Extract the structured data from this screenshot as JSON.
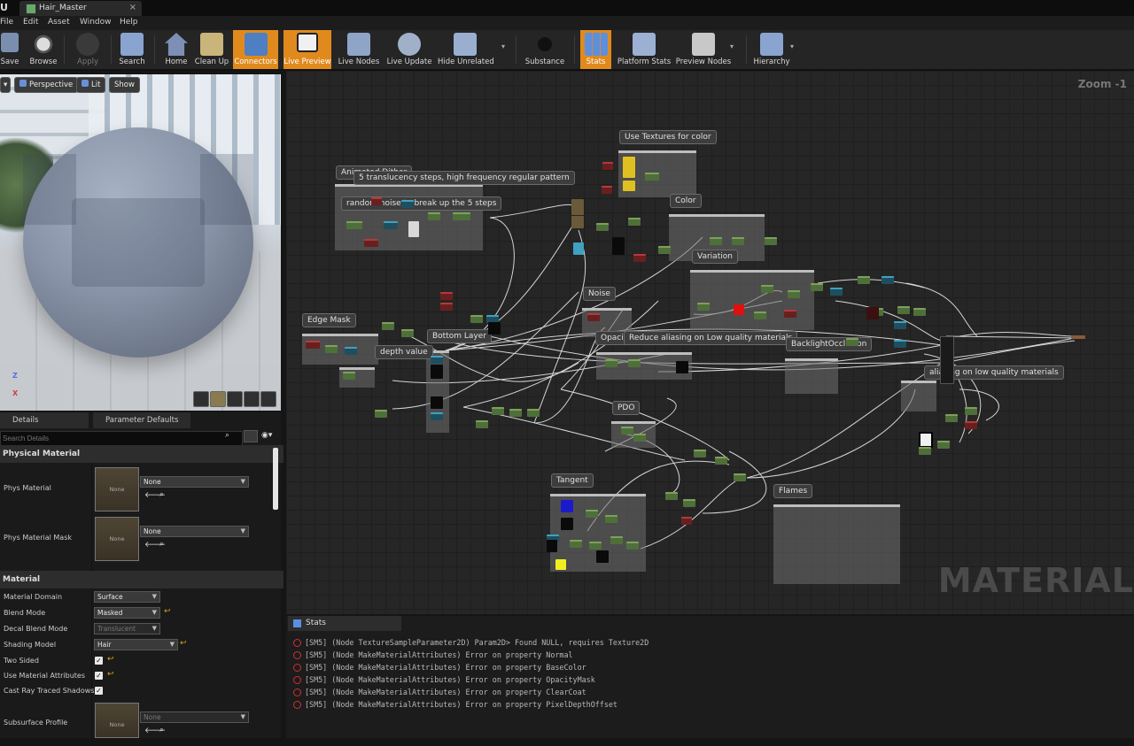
{
  "tab": {
    "title": "Hair_Master"
  },
  "menu": [
    "File",
    "Edit",
    "Asset",
    "Window",
    "Help"
  ],
  "toolbar": [
    {
      "label": "Save",
      "icon": "save-icon"
    },
    {
      "label": "Browse",
      "icon": "browse-icon"
    },
    {
      "label": "Apply",
      "icon": "apply-icon"
    },
    {
      "label": "Search",
      "icon": "search-icon"
    },
    {
      "label": "Home",
      "icon": "home-icon"
    },
    {
      "label": "Clean Up",
      "icon": "clean-up-icon"
    },
    {
      "label": "Connectors",
      "icon": "connectors-icon",
      "active": true
    },
    {
      "label": "Live Preview",
      "icon": "live-preview-icon",
      "active": true
    },
    {
      "label": "Live Nodes",
      "icon": "live-nodes-icon"
    },
    {
      "label": "Live Update",
      "icon": "live-update-icon"
    },
    {
      "label": "Hide Unrelated",
      "icon": "hide-unrelated-icon"
    },
    {
      "label": "Substance",
      "icon": "substance-icon"
    },
    {
      "label": "Stats",
      "icon": "stats-icon",
      "active": true
    },
    {
      "label": "Platform Stats",
      "icon": "platform-stats-icon"
    },
    {
      "label": "Preview Nodes",
      "icon": "preview-nodes-icon"
    },
    {
      "label": "Hierarchy",
      "icon": "hierarchy-icon"
    }
  ],
  "viewport": {
    "perspective": "Perspective",
    "lit": "Lit",
    "show": "Show",
    "axis_z": "Z",
    "axis_x": "X"
  },
  "details": {
    "tab_details": "Details",
    "tab_params": "Parameter Defaults",
    "search_placeholder": "Search Details",
    "physical_material": {
      "title": "Physical Material",
      "phys_material_label": "Phys Material",
      "phys_material_value": "None",
      "phys_mask_label": "Phys Material Mask",
      "phys_mask_value": "None",
      "thumb_text": "None"
    },
    "material": {
      "title": "Material",
      "domain_label": "Material Domain",
      "domain_value": "Surface",
      "blend_label": "Blend Mode",
      "blend_value": "Masked",
      "decal_label": "Decal Blend Mode",
      "decal_value": "Translucent",
      "shading_label": "Shading Model",
      "shading_value": "Hair",
      "two_sided_label": "Two Sided",
      "use_attr_label": "Use Material Attributes",
      "cast_ray_label": "Cast Ray Traced Shadows",
      "subsurface_label": "Subsurface Profile",
      "subsurface_value": "None",
      "thumb_text": "None"
    }
  },
  "graph": {
    "zoom": "Zoom -1",
    "watermark": "MATERIAL",
    "comments": [
      "Use Textures for color",
      "Animated Dither",
      "5 translucency steps, high frequency regular pattern",
      "random noise to break up the 5 steps",
      "Color",
      "Variation",
      "Noise",
      "Edge Mask",
      "Bottom Layer",
      "depth value",
      "OpacityMask",
      "Reduce aliasing on Low quality materials",
      "BacklightOcclusion",
      "aliasing on low quality materials",
      "PDO",
      "Tangent",
      "Flames"
    ]
  },
  "stats": {
    "tab": "Stats",
    "errors": [
      "[SM5] (Node TextureSampleParameter2D) Param2D> Found NULL, requires Texture2D",
      "[SM5] (Node MakeMaterialAttributes) Error on property Normal",
      "[SM5] (Node MakeMaterialAttributes) Error on property BaseColor",
      "[SM5] (Node MakeMaterialAttributes) Error on property OpacityMask",
      "[SM5] (Node MakeMaterialAttributes) Error on property ClearCoat",
      "[SM5] (Node MakeMaterialAttributes) Error on property PixelDepthOffset"
    ]
  },
  "colors": {
    "accent": "#e08a1e",
    "error": "#d23030",
    "graph_bg": "#262626"
  }
}
